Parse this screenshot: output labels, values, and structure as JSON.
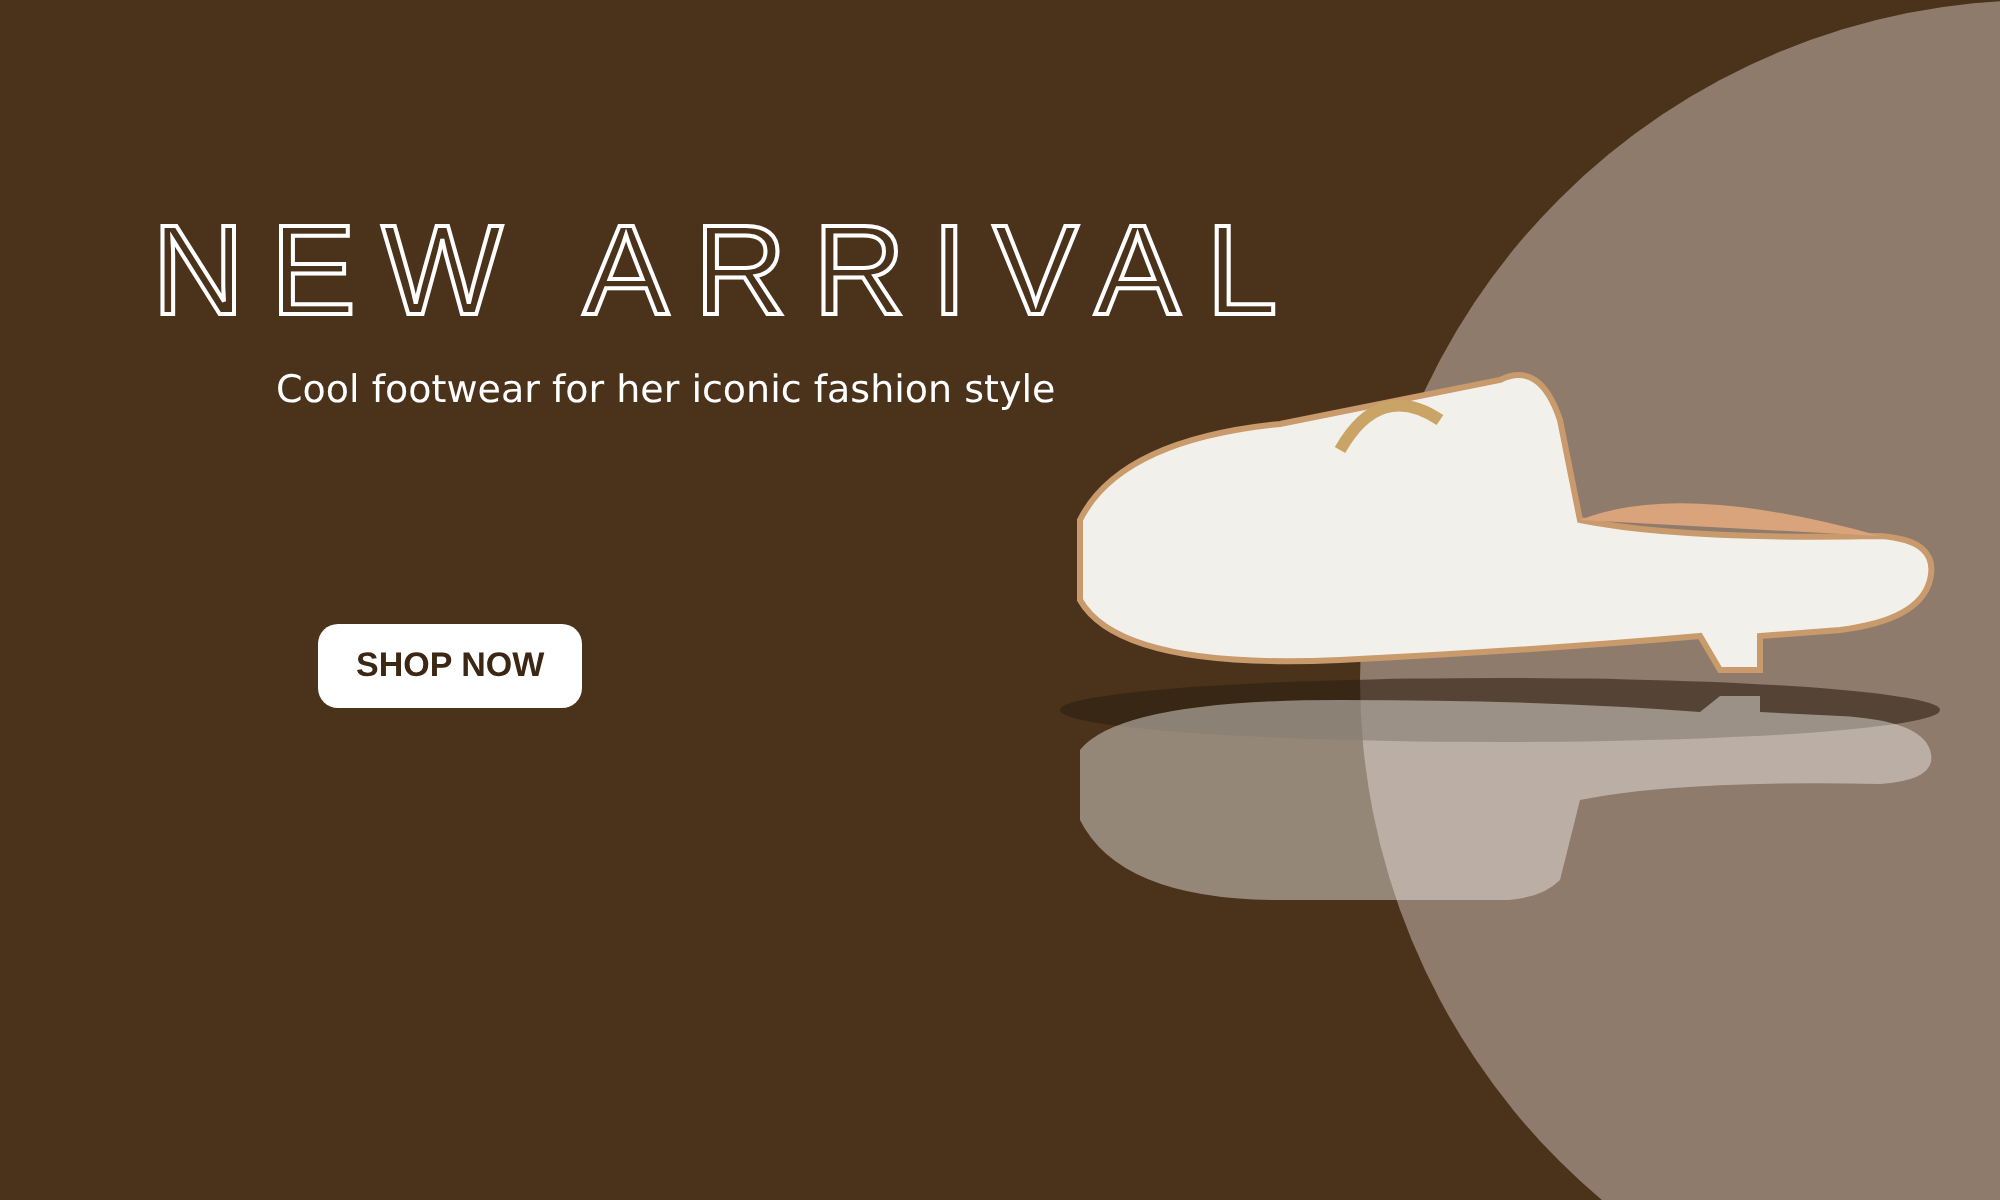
{
  "banner": {
    "title": "NEW ARRIVAL",
    "subtitle": "Cool footwear for her iconic fashion style",
    "button": "SHOP NOW"
  }
}
